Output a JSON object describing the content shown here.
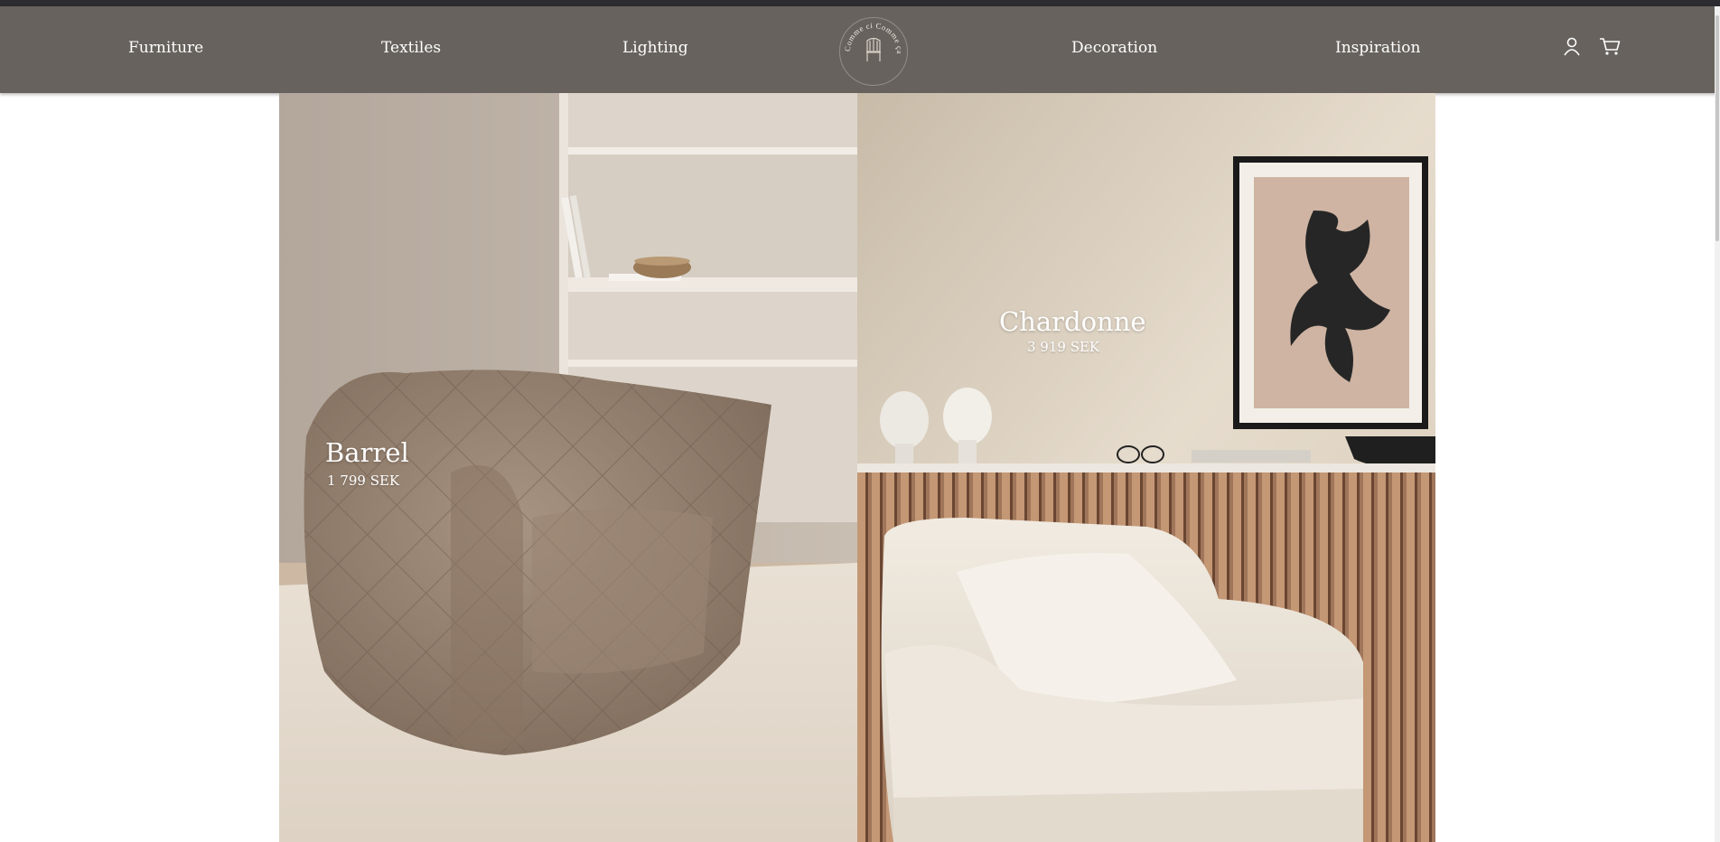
{
  "nav": {
    "left": [
      "Furniture",
      "Textiles",
      "Lighting"
    ],
    "right": [
      "Decoration",
      "Inspiration"
    ],
    "logo_text": "Comme ci Comme ça"
  },
  "icons": {
    "account": "user-icon",
    "cart": "cart-icon"
  },
  "products": [
    {
      "name": "Barrel",
      "price": "1 799 SEK"
    },
    {
      "name": "Chardonne",
      "price": "3 919 SEK"
    }
  ],
  "colors": {
    "nav_background": "#67625d",
    "top_line": "#2b2b30",
    "text": "#ffffff"
  }
}
